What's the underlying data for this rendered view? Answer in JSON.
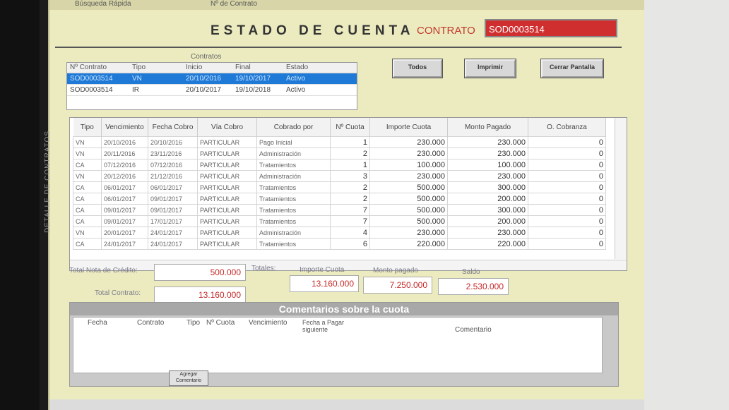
{
  "topbar": {
    "busqueda": "Búsqueda Rápida",
    "nro_contrato": "Nº de Contrato"
  },
  "header": {
    "title": "ESTADO DE CUENTA",
    "contrato_label": "CONTRATO",
    "contrato_value": "SOD0003514"
  },
  "contratos": {
    "label": "Contratos",
    "columns": [
      "Nº Contrato",
      "Tipo",
      "Inicio",
      "Final",
      "Estado"
    ],
    "rows": [
      {
        "contrato": "SOD0003514",
        "tipo": "VN",
        "inicio": "20/10/2016",
        "final": "19/10/2017",
        "estado": "Activo"
      },
      {
        "contrato": "SOD0003514",
        "tipo": "IR",
        "inicio": "20/10/2017",
        "final": "19/10/2018",
        "estado": "Activo"
      }
    ]
  },
  "buttons": {
    "todos": "Todos",
    "imprimir": "Imprimir",
    "cerrar": "Cerrar Pantalla"
  },
  "cuotas": {
    "columns": [
      "Tipo",
      "Vencimiento",
      "Fecha Cobro",
      "Vía Cobro",
      "Cobrado por",
      "Nº Cuota",
      "Importe Cuota",
      "Monto Pagado",
      "O. Cobranza"
    ],
    "rows": [
      {
        "tipo": "VN",
        "venc": "20/10/2016",
        "fecha": "20/10/2016",
        "via": "PARTICULAR",
        "cobrado": "Pago Inicial",
        "nro": "1",
        "importe": "230.000",
        "pagado": "230.000",
        "ocob": "0"
      },
      {
        "tipo": "VN",
        "venc": "20/11/2016",
        "fecha": "23/11/2016",
        "via": "PARTICULAR",
        "cobrado": "Administración",
        "nro": "2",
        "importe": "230.000",
        "pagado": "230.000",
        "ocob": "0"
      },
      {
        "tipo": "CA",
        "venc": "07/12/2016",
        "fecha": "07/12/2016",
        "via": "PARTICULAR",
        "cobrado": "Tratamientos",
        "nro": "1",
        "importe": "100.000",
        "pagado": "100.000",
        "ocob": "0"
      },
      {
        "tipo": "VN",
        "venc": "20/12/2016",
        "fecha": "21/12/2016",
        "via": "PARTICULAR",
        "cobrado": "Administración",
        "nro": "3",
        "importe": "230.000",
        "pagado": "230.000",
        "ocob": "0"
      },
      {
        "tipo": "CA",
        "venc": "06/01/2017",
        "fecha": "06/01/2017",
        "via": "PARTICULAR",
        "cobrado": "Tratamientos",
        "nro": "2",
        "importe": "500.000",
        "pagado": "300.000",
        "ocob": "0"
      },
      {
        "tipo": "CA",
        "venc": "06/01/2017",
        "fecha": "09/01/2017",
        "via": "PARTICULAR",
        "cobrado": "Tratamientos",
        "nro": "2",
        "importe": "500.000",
        "pagado": "200.000",
        "ocob": "0"
      },
      {
        "tipo": "CA",
        "venc": "09/01/2017",
        "fecha": "09/01/2017",
        "via": "PARTICULAR",
        "cobrado": "Tratamientos",
        "nro": "7",
        "importe": "500.000",
        "pagado": "300.000",
        "ocob": "0"
      },
      {
        "tipo": "CA",
        "venc": "09/01/2017",
        "fecha": "17/01/2017",
        "via": "PARTICULAR",
        "cobrado": "Tratamientos",
        "nro": "7",
        "importe": "500.000",
        "pagado": "200.000",
        "ocob": "0"
      },
      {
        "tipo": "VN",
        "venc": "20/01/2017",
        "fecha": "24/01/2017",
        "via": "PARTICULAR",
        "cobrado": "Administración",
        "nro": "4",
        "importe": "230.000",
        "pagado": "230.000",
        "ocob": "0"
      },
      {
        "tipo": "CA",
        "venc": "24/01/2017",
        "fecha": "24/01/2017",
        "via": "PARTICULAR",
        "cobrado": "Tratamientos",
        "nro": "6",
        "importe": "220.000",
        "pagado": "220.000",
        "ocob": "0"
      }
    ]
  },
  "side_label": "DETALLE DE CONTRATOS",
  "totales": {
    "nota_credito_label": "Total Nota de Crédito:",
    "nota_credito": "500.000",
    "contrato_label": "Total Contrato:",
    "contrato": "13.160.000",
    "totales_label": "Totales:",
    "importe_label": "Importe Cuota",
    "importe": "13.160.000",
    "pagado_label": "Monto pagado",
    "pagado": "7.250.000",
    "saldo_label": "Saldo",
    "saldo": "2.530.000"
  },
  "comentarios": {
    "title": "Comentarios sobre la cuota",
    "columns": [
      "Fecha",
      "Contrato",
      "Tipo",
      "Nº Cuota",
      "Vencimiento",
      "Fecha a Pagar siguiente",
      "Comentario"
    ],
    "agregar": "Agregar Comentario"
  }
}
